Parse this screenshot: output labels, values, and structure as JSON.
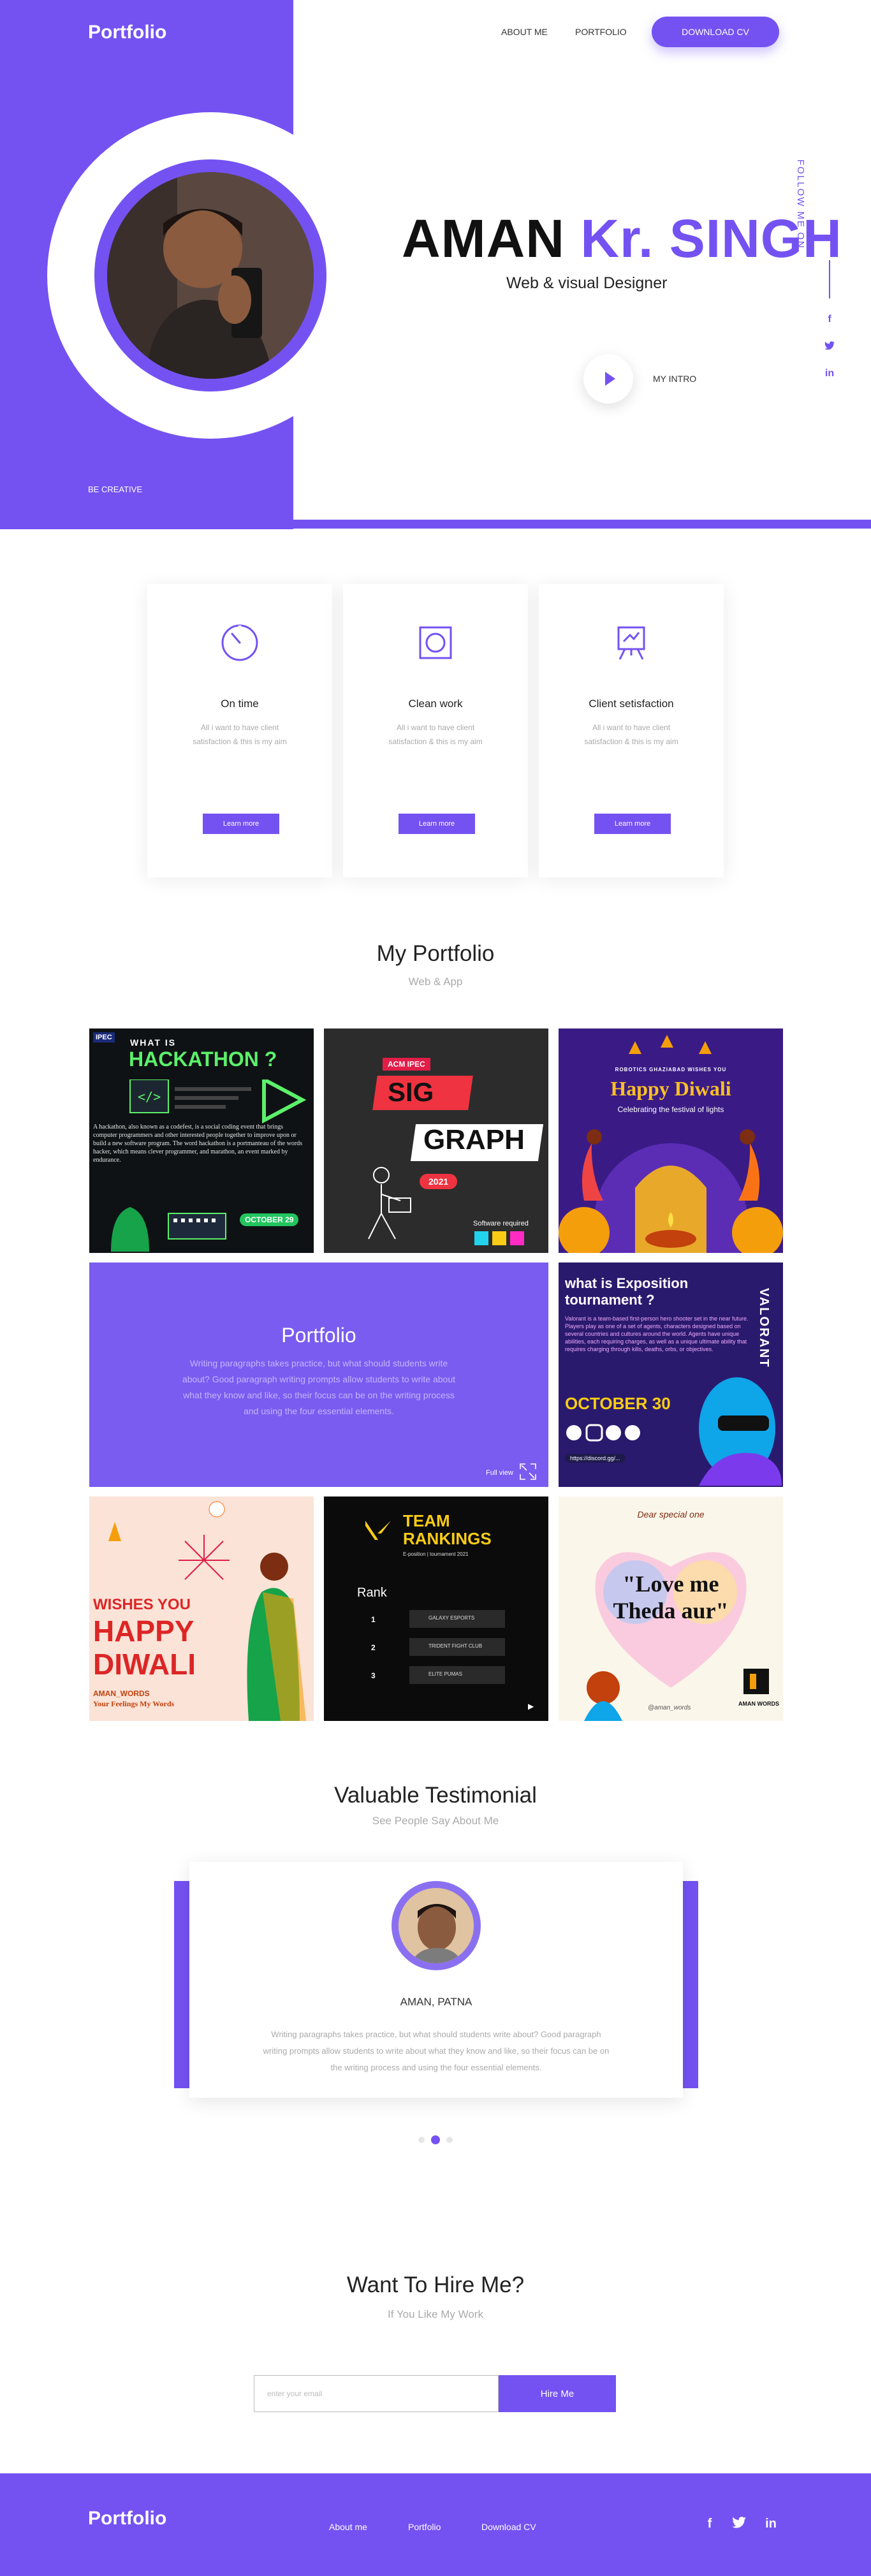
{
  "header": {
    "logo": "Portfolio",
    "nav": [
      "ABOUT ME",
      "PORTFOLIO"
    ],
    "cta": "DOWNLOAD CV"
  },
  "hero": {
    "name_first": "AMAN",
    "name_accent": "Kr. SINGH",
    "role": "Web & visual Designer",
    "intro_label": "MY INTRO",
    "tagline": "BE CREATIVE",
    "follow_label": "FOLLOW ME ON",
    "social_icons": [
      "facebook-icon",
      "twitter-icon",
      "linkedin-icon"
    ]
  },
  "services": [
    {
      "icon": "clock-icon",
      "title": "On time",
      "desc": "All i want to have client satisfaction & this is my aim",
      "button": "Learn more"
    },
    {
      "icon": "square-frame-icon",
      "title": "Clean work",
      "desc": "All i want to have client satisfaction & this is my aim",
      "button": "Learn more"
    },
    {
      "icon": "easel-icon",
      "title": "Client setisfaction",
      "desc": "All i want to have client satisfaction & this is my aim",
      "button": "Learn more"
    }
  ],
  "portfolio": {
    "title": "My Portfolio",
    "subtitle": "Web & App",
    "tiles": {
      "hackathon": {
        "heading": "WHAT IS",
        "title": "HACKATHON ?",
        "body": "A hackathon, also known as a codefest, is a social coding event that brings computer programmers and other interested people together to improve upon or build a new software program. The word hackathon is a portmanteau of the words hacker, which means clever programmer, and marathon, an event marked by endurance.",
        "date": "OCTOBER 29",
        "logo": "IPEC"
      },
      "siggraph": {
        "badge": "ACM IPEC",
        "sig": "SIG",
        "graph": "GRAPH",
        "year": "2021",
        "note": "Software required"
      },
      "diwali_fest": {
        "kicker": "ROBOTICS GHAZIABAD WISHES YOU",
        "title": "Happy Diwali",
        "subtitle": "Celebrating the festival of lights"
      },
      "featured": {
        "title": "Portfolio",
        "text": "Writing paragraphs takes practice, but what should students write about? Good paragraph writing prompts allow students to write about what they know and like, so their focus can be on the writing process and using the four essential elements.",
        "view_label": "Full view"
      },
      "exposition": {
        "title": "what is Exposition tournament ?",
        "body": "Valorant is a team-based first-person hero shooter set in the near future. Players play as one of a set of agents, characters designed based on several countries and cultures around the world. Agents have unique abilities, each requiring charges, as well as a unique ultimate ability that requires charging through kills, deaths, orbs, or objectives.",
        "date": "OCTOBER 30",
        "url": "https://discord.gg/...",
        "side": "VALORANT"
      },
      "wishes": {
        "line1": "WISHES YOU",
        "line2": "HAPPY",
        "line3": "DIWALI",
        "brand": "AMAN_WORDS",
        "tagline": "Your Feelings My Words"
      },
      "rankings": {
        "title": "TEAM RANKINGS",
        "subtitle": "E-position | tournament 2021",
        "rank_label": "Rank",
        "teams": [
          {
            "rank": "1",
            "name": "GALAXY ESPORTS"
          },
          {
            "rank": "2",
            "name": "TRIDENT FIGHT CLUB"
          },
          {
            "rank": "3",
            "name": "ELITE PUMAS"
          }
        ]
      },
      "loveme": {
        "top": "Dear special one",
        "text": "\"Love me Theda aur\"",
        "handle": "@aman_words",
        "brand": "AMAN WORDS"
      }
    }
  },
  "testimonial": {
    "title": "Valuable Testimonial",
    "subtitle": "See People Say About Me",
    "name": "AMAN, PATNA",
    "text": "Writing paragraphs takes practice, but what should students write about? Good paragraph writing prompts allow students to write about what they know and like, so their focus can be on the writing process and using the four essential elements."
  },
  "hire": {
    "title": "Want To Hire Me?",
    "subtitle": "If You Like My Work",
    "placeholder": "enter your email",
    "button": "Hire Me"
  },
  "footer": {
    "logo": "Portfolio",
    "links": [
      "About me",
      "Portfolio",
      "Download CV"
    ],
    "social": [
      "f",
      "t",
      "in"
    ]
  },
  "colors": {
    "accent": "#7452f2"
  }
}
